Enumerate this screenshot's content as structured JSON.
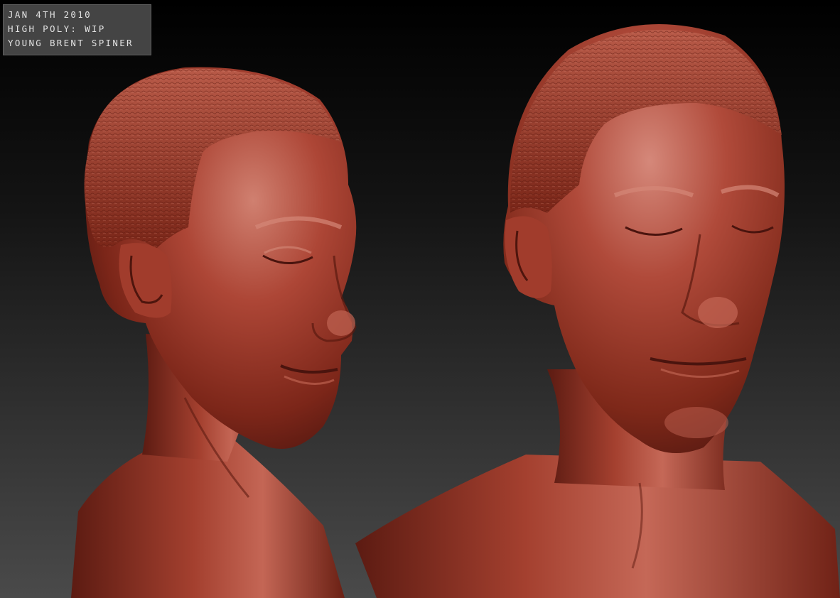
{
  "caption": {
    "line1": "JAN 4TH 2010",
    "line2": "HIGH POLY: WIP",
    "line3": "YOUNG BRENT SPINER"
  },
  "colors": {
    "background_top": "#000000",
    "background_bottom": "#4a4a4a",
    "clay": "#9a3a2c",
    "clay_highlight": "#d9897a",
    "clay_shadow": "#4a140e",
    "caption_box": "#444444",
    "caption_text": "#e2e2e2"
  },
  "subjects": [
    {
      "name": "sculpt-view-three-quarter",
      "icon": "clay-bust-three-quarter"
    },
    {
      "name": "sculpt-view-front",
      "icon": "clay-bust-front"
    }
  ]
}
